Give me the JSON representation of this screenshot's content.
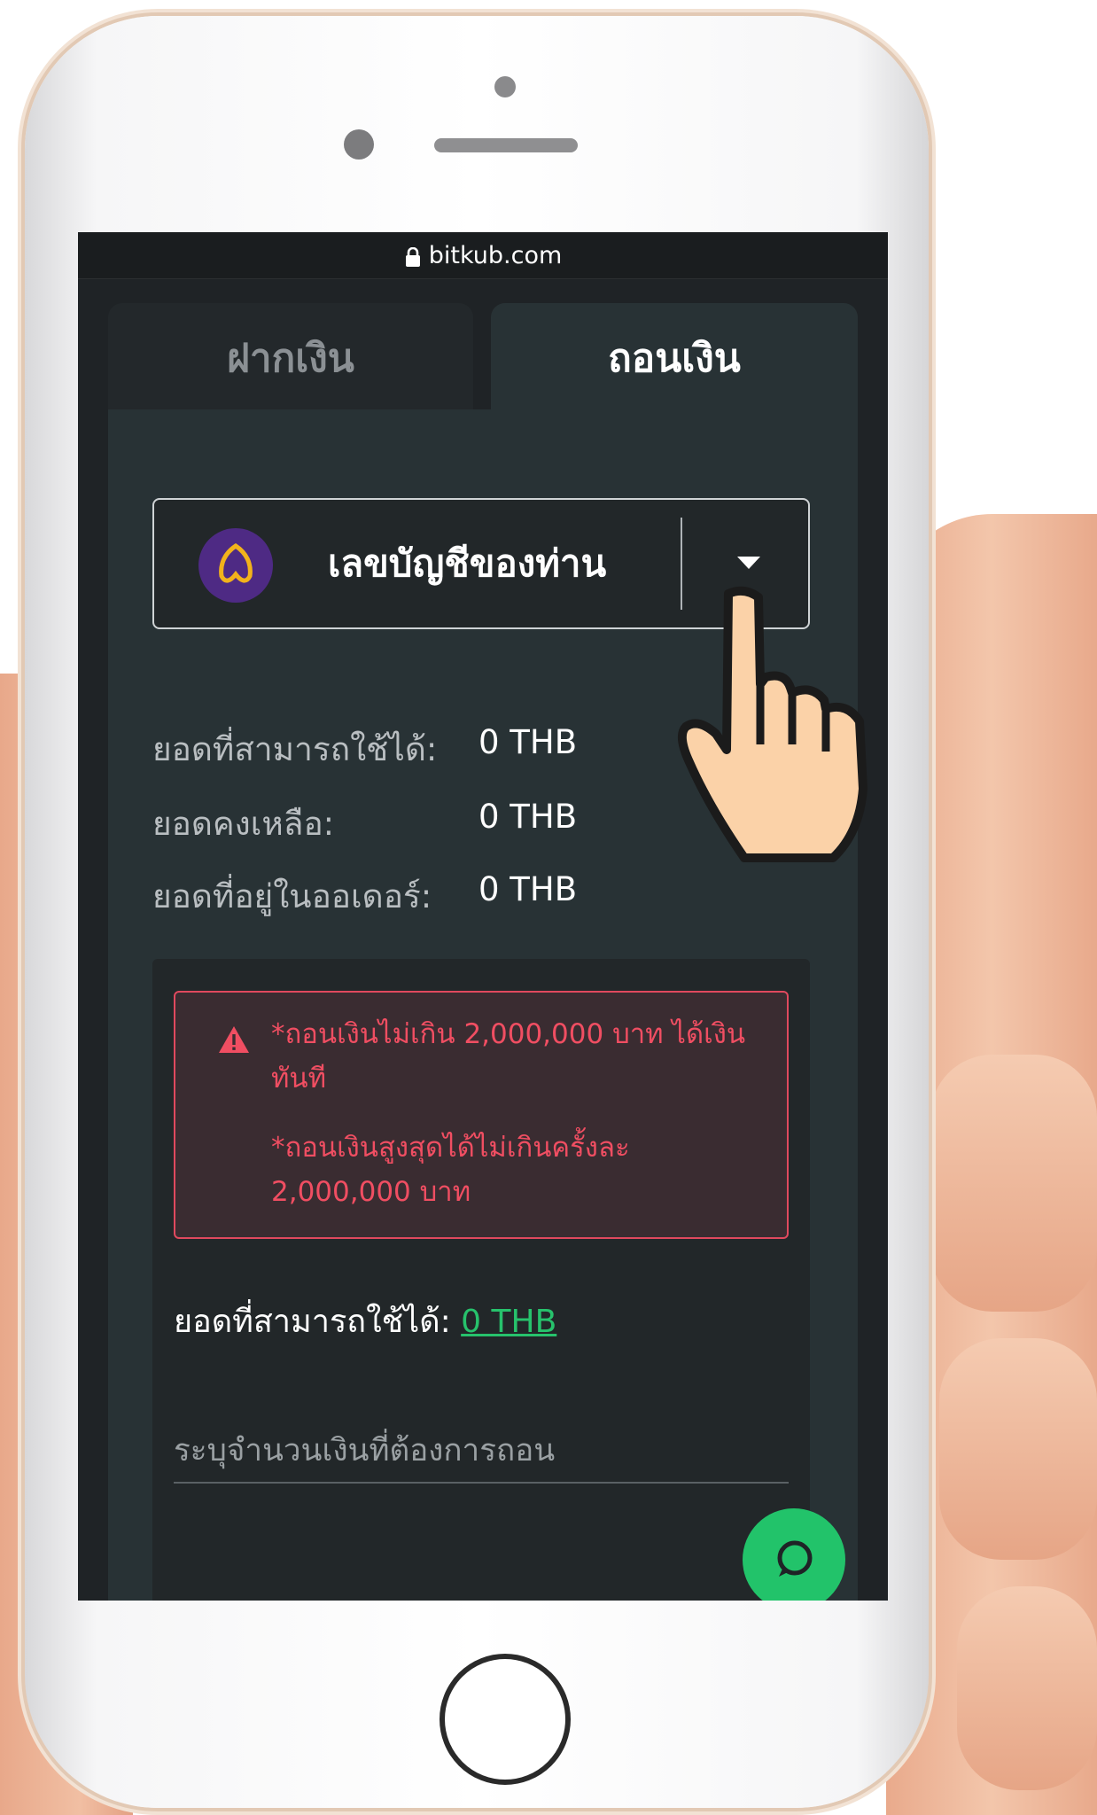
{
  "browser": {
    "url": "bitkub.com"
  },
  "tabs": [
    {
      "label": "ฝากเงิน",
      "active": false
    },
    {
      "label": "ถอนเงิน",
      "active": true
    }
  ],
  "bank_select": {
    "label": "เลขบัญชีของท่าน",
    "icon": "bank-logo"
  },
  "balances": [
    {
      "label": "ยอดที่สามารถใช้ได้:",
      "value": "0 THB"
    },
    {
      "label": "ยอดคงเหลือ:",
      "value": "0 THB"
    },
    {
      "label": "ยอดที่อยู่ในออเดอร์:",
      "value": "0 THB"
    }
  ],
  "warning": {
    "line1": "*ถอนเงินไม่เกิน 2,000,000 บาท ได้เงินทันที",
    "line2": "*ถอนเงินสูงสุดได้ไม่เกินครั้งละ 2,000,000 บาท"
  },
  "available": {
    "label": "ยอดที่สามารถใช้ได้:",
    "value": "0 THB"
  },
  "amount_input": {
    "placeholder": "ระบุจำนวนเงินที่ต้องการถอน",
    "value": ""
  },
  "colors": {
    "accent_green": "#22c36a",
    "warning_red": "#f04e62",
    "panel": "#283235"
  }
}
